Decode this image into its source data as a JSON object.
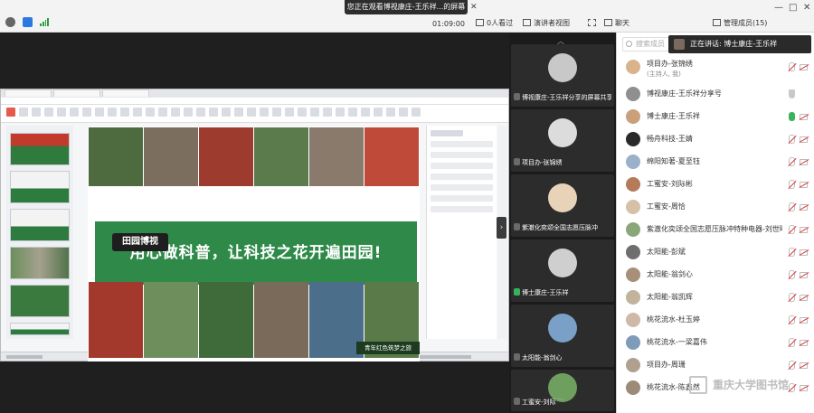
{
  "share_banner": "您正在观看博视康庄-王乐祥...的屏幕",
  "toolbar": {
    "timer": "01:09:00",
    "viewer_count": "0人看过",
    "view_mode": "演讲者视图",
    "chat": "聊天",
    "members": "管理成员(15)"
  },
  "search_placeholder": "搜索成员",
  "speaking_now": "正在讲话: 博士康庄-王乐祥",
  "slide": {
    "title": "用心做科普，让科技之花开遍田园!",
    "logo": "田园博视",
    "youth_tag": "青年红色筑梦之旅"
  },
  "video_tiles": [
    {
      "name": "博视康庄-王乐祥分享的屏幕共享",
      "mic": "muted"
    },
    {
      "name": "项目办-张锦绣",
      "mic": "muted"
    },
    {
      "name": "紫澈化奕颂全国志愿压脉冲",
      "mic": "muted"
    },
    {
      "name": "博士康庄-王乐祥",
      "mic": "on"
    },
    {
      "name": "太阳能-翁剑心",
      "mic": "muted"
    },
    {
      "name": "工蜜安-刘际",
      "mic": "muted"
    }
  ],
  "participants": [
    {
      "name": "项目办-张锦绣",
      "sub": "(主持人, 我)",
      "mic": "muted",
      "video": "off"
    },
    {
      "name": "博视康庄-王乐祥分享号",
      "sub": "",
      "mic": "shield",
      "video": "none"
    },
    {
      "name": "博士康庄-王乐祥",
      "sub": "",
      "mic": "on",
      "video": "off"
    },
    {
      "name": "畅舟科技-王婧",
      "sub": "",
      "mic": "muted",
      "video": "off"
    },
    {
      "name": "绵阳知著-夏至钰",
      "sub": "",
      "mic": "muted",
      "video": "off"
    },
    {
      "name": "工蜜安-刘际彬",
      "sub": "",
      "mic": "muted",
      "video": "off"
    },
    {
      "name": "工蜜安-周恰",
      "sub": "",
      "mic": "muted",
      "video": "off"
    },
    {
      "name": "紫澈化奕颂全国志愿压脉冲特种电器-刘世曦",
      "sub": "",
      "mic": "muted",
      "video": "off"
    },
    {
      "name": "太阳能-彭斌",
      "sub": "",
      "mic": "muted",
      "video": "off"
    },
    {
      "name": "太阳能-翁剑心",
      "sub": "",
      "mic": "muted",
      "video": "off"
    },
    {
      "name": "太阳能-翁凯辉",
      "sub": "",
      "mic": "muted",
      "video": "off"
    },
    {
      "name": "桃花流水-杜玉婷",
      "sub": "",
      "mic": "muted",
      "video": "off"
    },
    {
      "name": "桃花流水-一梁嘉伟",
      "sub": "",
      "mic": "muted",
      "video": "off"
    },
    {
      "name": "项目办-周珊",
      "sub": "",
      "mic": "muted",
      "video": "off"
    },
    {
      "name": "桃花流水-陈鑫然",
      "sub": "",
      "mic": "muted",
      "video": "off"
    }
  ],
  "watermark": "重庆大学图书馆",
  "colors": {
    "slide_green": "#2f8a4a",
    "mic_on": "#3bb35c",
    "mic_muted_slash": "#dd3333"
  }
}
